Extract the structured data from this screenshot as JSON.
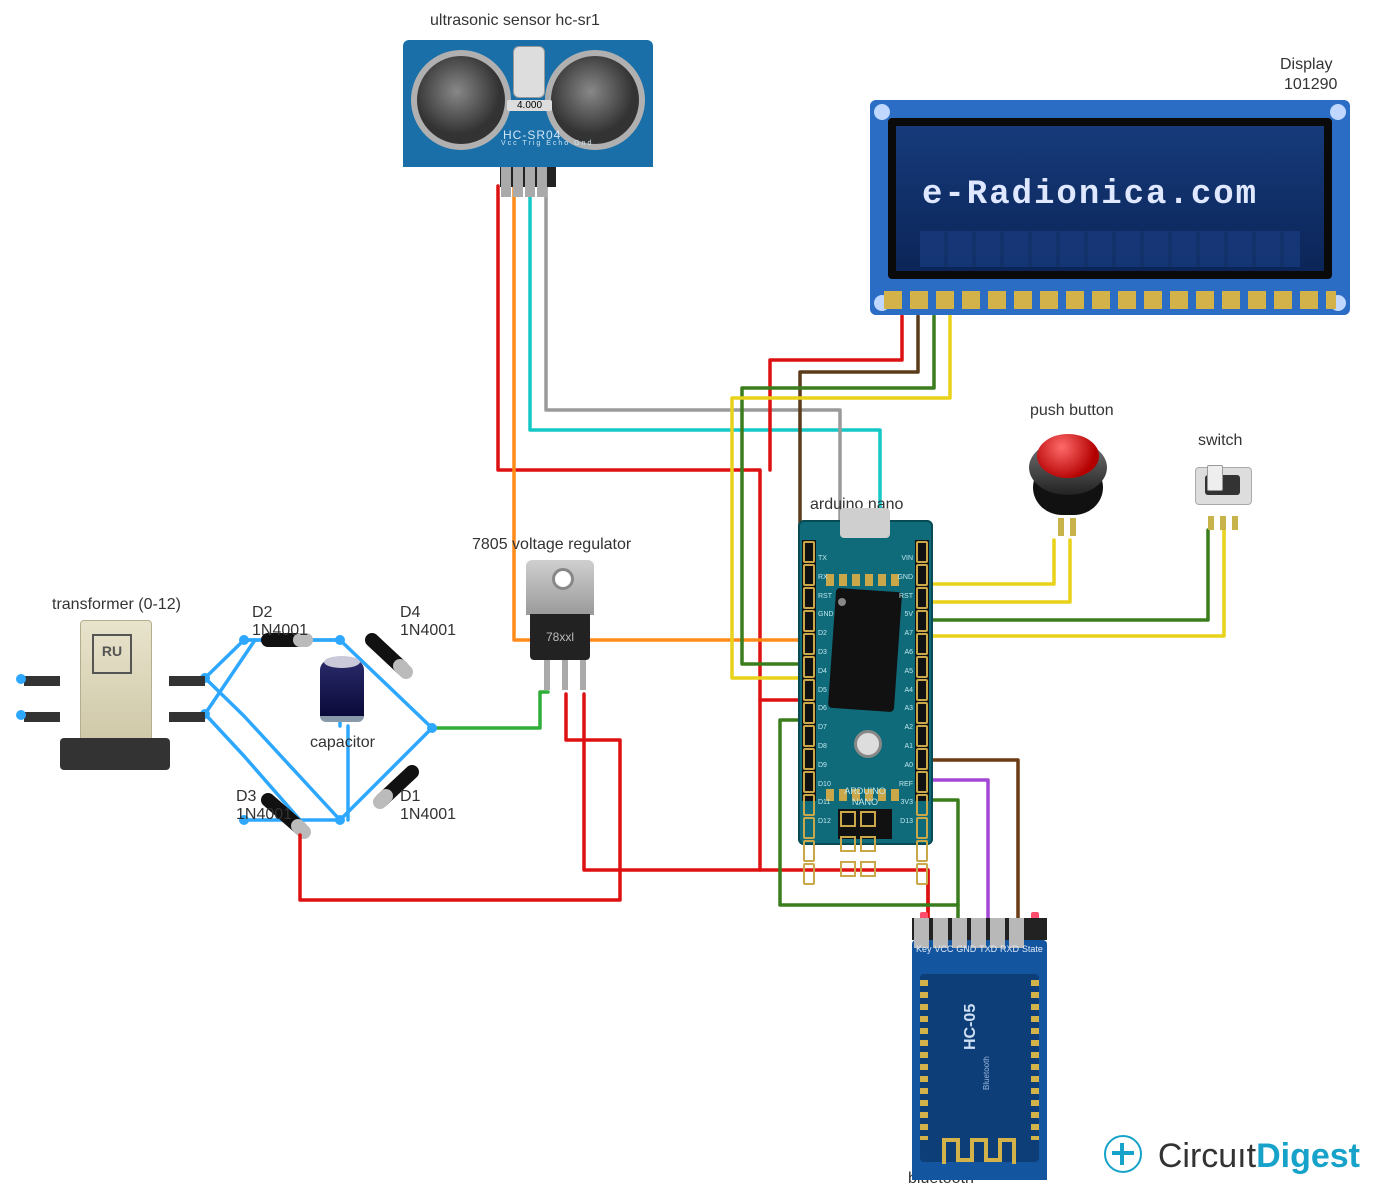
{
  "labels": {
    "ultrasonic": "ultrasonic sensor hc-sr1",
    "display_top": "Display",
    "display_id": "101290",
    "push_button": "push button",
    "switch": "switch",
    "vreg": "7805 voltage regulator",
    "nano": "arduino nano",
    "transformer": "transformer (0-12)",
    "capacitor": "capacitor",
    "bluetooth": "bluetooth",
    "d1": "D1\n1N4001",
    "d2": "D2\n1N4001",
    "d3": "D3\n1N4001",
    "d4": "D4\n1N4001"
  },
  "hcsr04": {
    "crystal": "4.000",
    "silk": "HC-SR04",
    "pins": "Vcc Trig Echo Gnd"
  },
  "lcd": {
    "text": "e-Radionica.com"
  },
  "vreg": {
    "marking": "78xxl"
  },
  "transformer": {
    "mark": "RU"
  },
  "nano": {
    "silk": "ARDUINO\nNANO\nV3.0",
    "left_pins": "TX\nRX\nRST\nGND\nD2\nD3\nD4\nD5\nD6\nD7\nD8\nD9\nD10\nD11\nD12",
    "right_pins": "VIN\nGND\nRST\n5V\nA7\nA6\nA5\nA4\nA3\nA2\nA1\nA0\nREF\n3V3\nD13"
  },
  "bt": {
    "name": "HC-05",
    "sub": "Bluetooth",
    "pins": [
      "Key",
      "VCC",
      "GND",
      "TXD",
      "RXD",
      "State"
    ]
  },
  "logo": {
    "a": "Circuıt",
    "b": "Digest"
  },
  "diodes": {
    "part": "1N4001",
    "refs": [
      "D1",
      "D2",
      "D3",
      "D4"
    ]
  },
  "wire_colors": {
    "vcc": "#d11",
    "gnd": "#5a3b1a",
    "trig": "#ff8c1a",
    "echo": "#16c7c7",
    "sda": "#3a7d1d",
    "scl": "#e8d21a",
    "grey": "#9a9a9a",
    "tx": "#a347d6",
    "rx": "#6b3c14",
    "blue": "#2ea7ff",
    "dc": "#2fae3a"
  }
}
